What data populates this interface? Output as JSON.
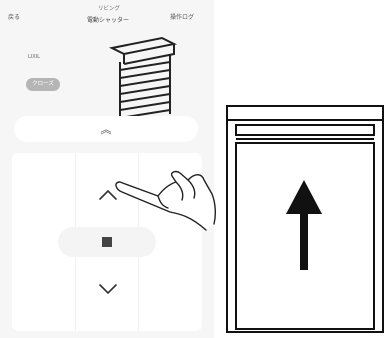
{
  "header": {
    "back_label": "戻る",
    "room_label": "リビング",
    "device_label": "電動シャッター",
    "log_label": "操作ログ"
  },
  "device": {
    "brand": "LIXIL",
    "status": "クローズ"
  },
  "controls": {
    "full_open_symbol": "︽",
    "up_icon": "chevron-up-icon",
    "stop_icon": "stop-icon",
    "down_icon": "chevron-down-icon"
  },
  "illustration": {
    "hand": "pointing-hand-icon",
    "diagram": "shutter-opening-up-arrow"
  }
}
